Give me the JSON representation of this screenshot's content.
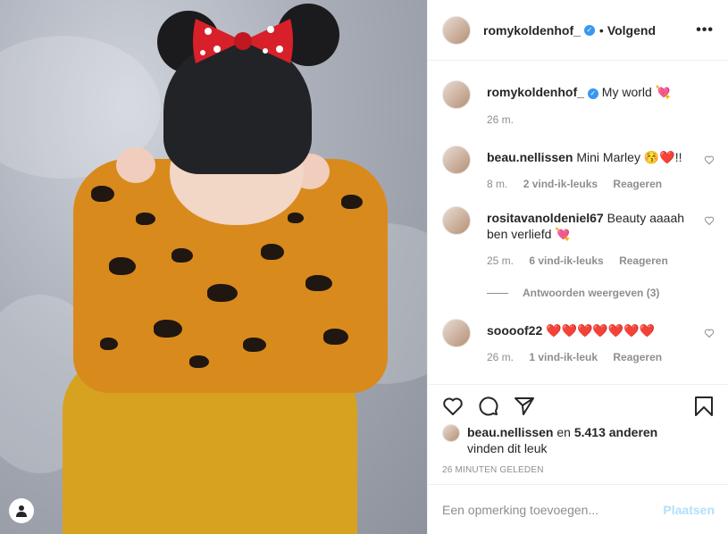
{
  "post": {
    "author": "romykoldenhof_",
    "following_label": "Volgend",
    "caption": "My world 💘",
    "caption_time": "26 m."
  },
  "comments": [
    {
      "user": "beau.nellissen",
      "text": "Mini Marley 😚❤️!!",
      "time": "8 m.",
      "likes": "2 vind-ik-leuks",
      "reply": "Reageren"
    },
    {
      "user": "rositavanoldeniel67",
      "text": "Beauty aaaah ben verliefd 💘",
      "time": "25 m.",
      "likes": "6 vind-ik-leuks",
      "reply": "Reageren"
    },
    {
      "user": "soooof22",
      "text": "❤️❤️❤️❤️❤️❤️❤️",
      "time": "26 m.",
      "likes": "1 vind-ik-leuk",
      "reply": "Reageren"
    }
  ],
  "view_replies": "Antwoorden weergeven (3)",
  "likes": {
    "user": "beau.nellissen",
    "and_label": "en",
    "others": "5.413 anderen",
    "suffix": "vinden dit leuk"
  },
  "timestamp": "26 MINUTEN GELEDEN",
  "add_comment": {
    "placeholder": "Een opmerking toevoegen...",
    "post_label": "Plaatsen"
  },
  "colors": {
    "verified": "#3897f0",
    "post_disabled": "#b2dffc",
    "muted": "#8e8e8e"
  },
  "icons": [
    "heart-icon",
    "comment-icon",
    "share-icon",
    "bookmark-icon",
    "more-icon",
    "verified-icon",
    "user-icon"
  ]
}
